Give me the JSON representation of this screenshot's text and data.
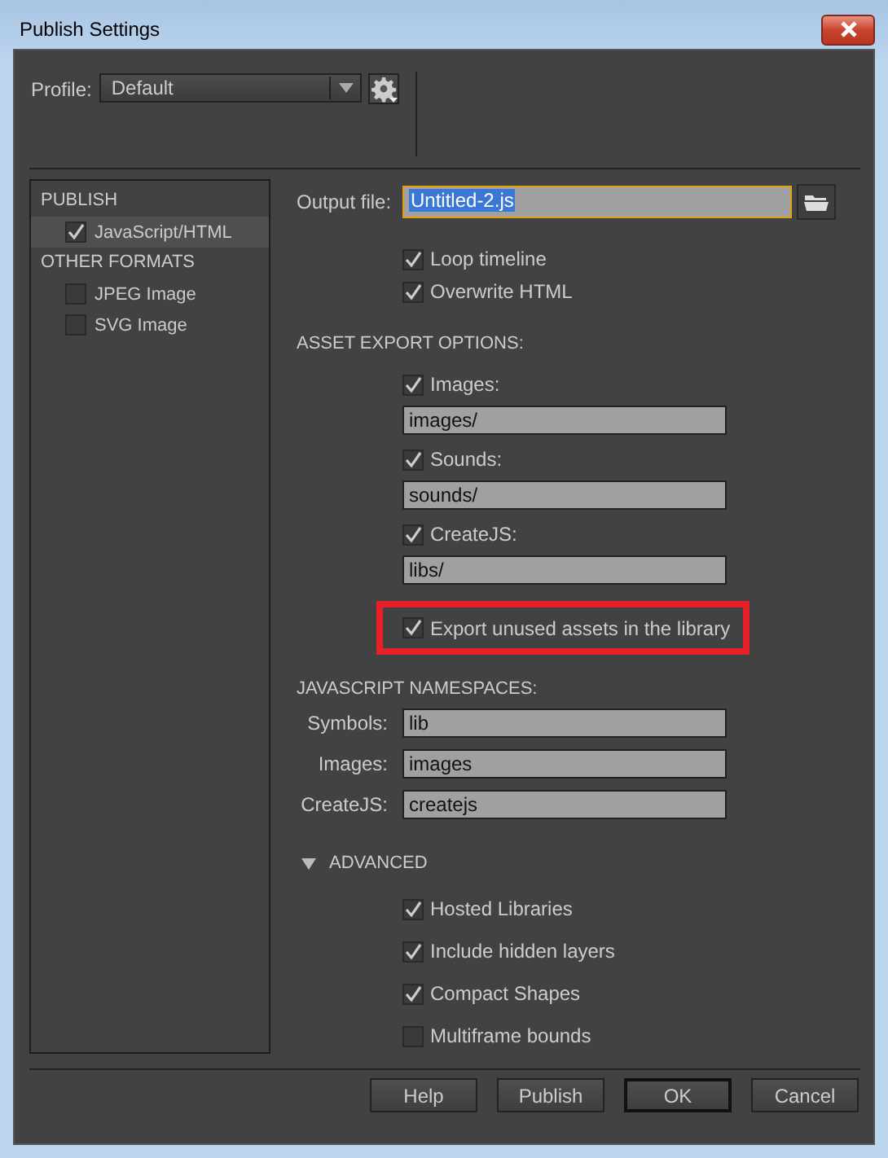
{
  "window": {
    "title": "Publish Settings"
  },
  "profile": {
    "label": "Profile:",
    "value": "Default"
  },
  "sidebar": {
    "sections": [
      {
        "heading": "PUBLISH",
        "items": [
          {
            "label": "JavaScript/HTML",
            "checked": true,
            "selected": true
          }
        ]
      },
      {
        "heading": "OTHER FORMATS",
        "items": [
          {
            "label": "JPEG Image",
            "checked": false,
            "selected": false
          },
          {
            "label": "SVG Image",
            "checked": false,
            "selected": false
          }
        ]
      }
    ]
  },
  "output_file": {
    "label": "Output file:",
    "value": "Untitled-2.js"
  },
  "options": [
    {
      "label": "Loop timeline",
      "checked": true
    },
    {
      "label": "Overwrite HTML",
      "checked": true
    }
  ],
  "asset_export": {
    "heading": "ASSET EXPORT OPTIONS:",
    "items": [
      {
        "label": "Images:",
        "checked": true,
        "value": "images/"
      },
      {
        "label": "Sounds:",
        "checked": true,
        "value": "sounds/"
      },
      {
        "label": "CreateJS:",
        "checked": true,
        "value": "libs/"
      }
    ],
    "unused": {
      "label": "Export unused assets in the library",
      "checked": true,
      "highlighted": true
    }
  },
  "namespaces": {
    "heading": "JAVASCRIPT NAMESPACES:",
    "fields": [
      {
        "label": "Symbols:",
        "value": "lib"
      },
      {
        "label": "Images:",
        "value": "images"
      },
      {
        "label": "CreateJS:",
        "value": "createjs"
      }
    ]
  },
  "advanced": {
    "label": "ADVANCED",
    "expanded": true,
    "options": [
      {
        "label": "Hosted Libraries",
        "checked": true
      },
      {
        "label": "Include hidden layers",
        "checked": true
      },
      {
        "label": "Compact Shapes",
        "checked": true
      },
      {
        "label": "Multiframe bounds",
        "checked": false
      }
    ]
  },
  "buttons": [
    {
      "label": "Help",
      "default": false
    },
    {
      "label": "Publish",
      "default": false
    },
    {
      "label": "OK",
      "default": true
    },
    {
      "label": "Cancel",
      "default": false
    }
  ]
}
